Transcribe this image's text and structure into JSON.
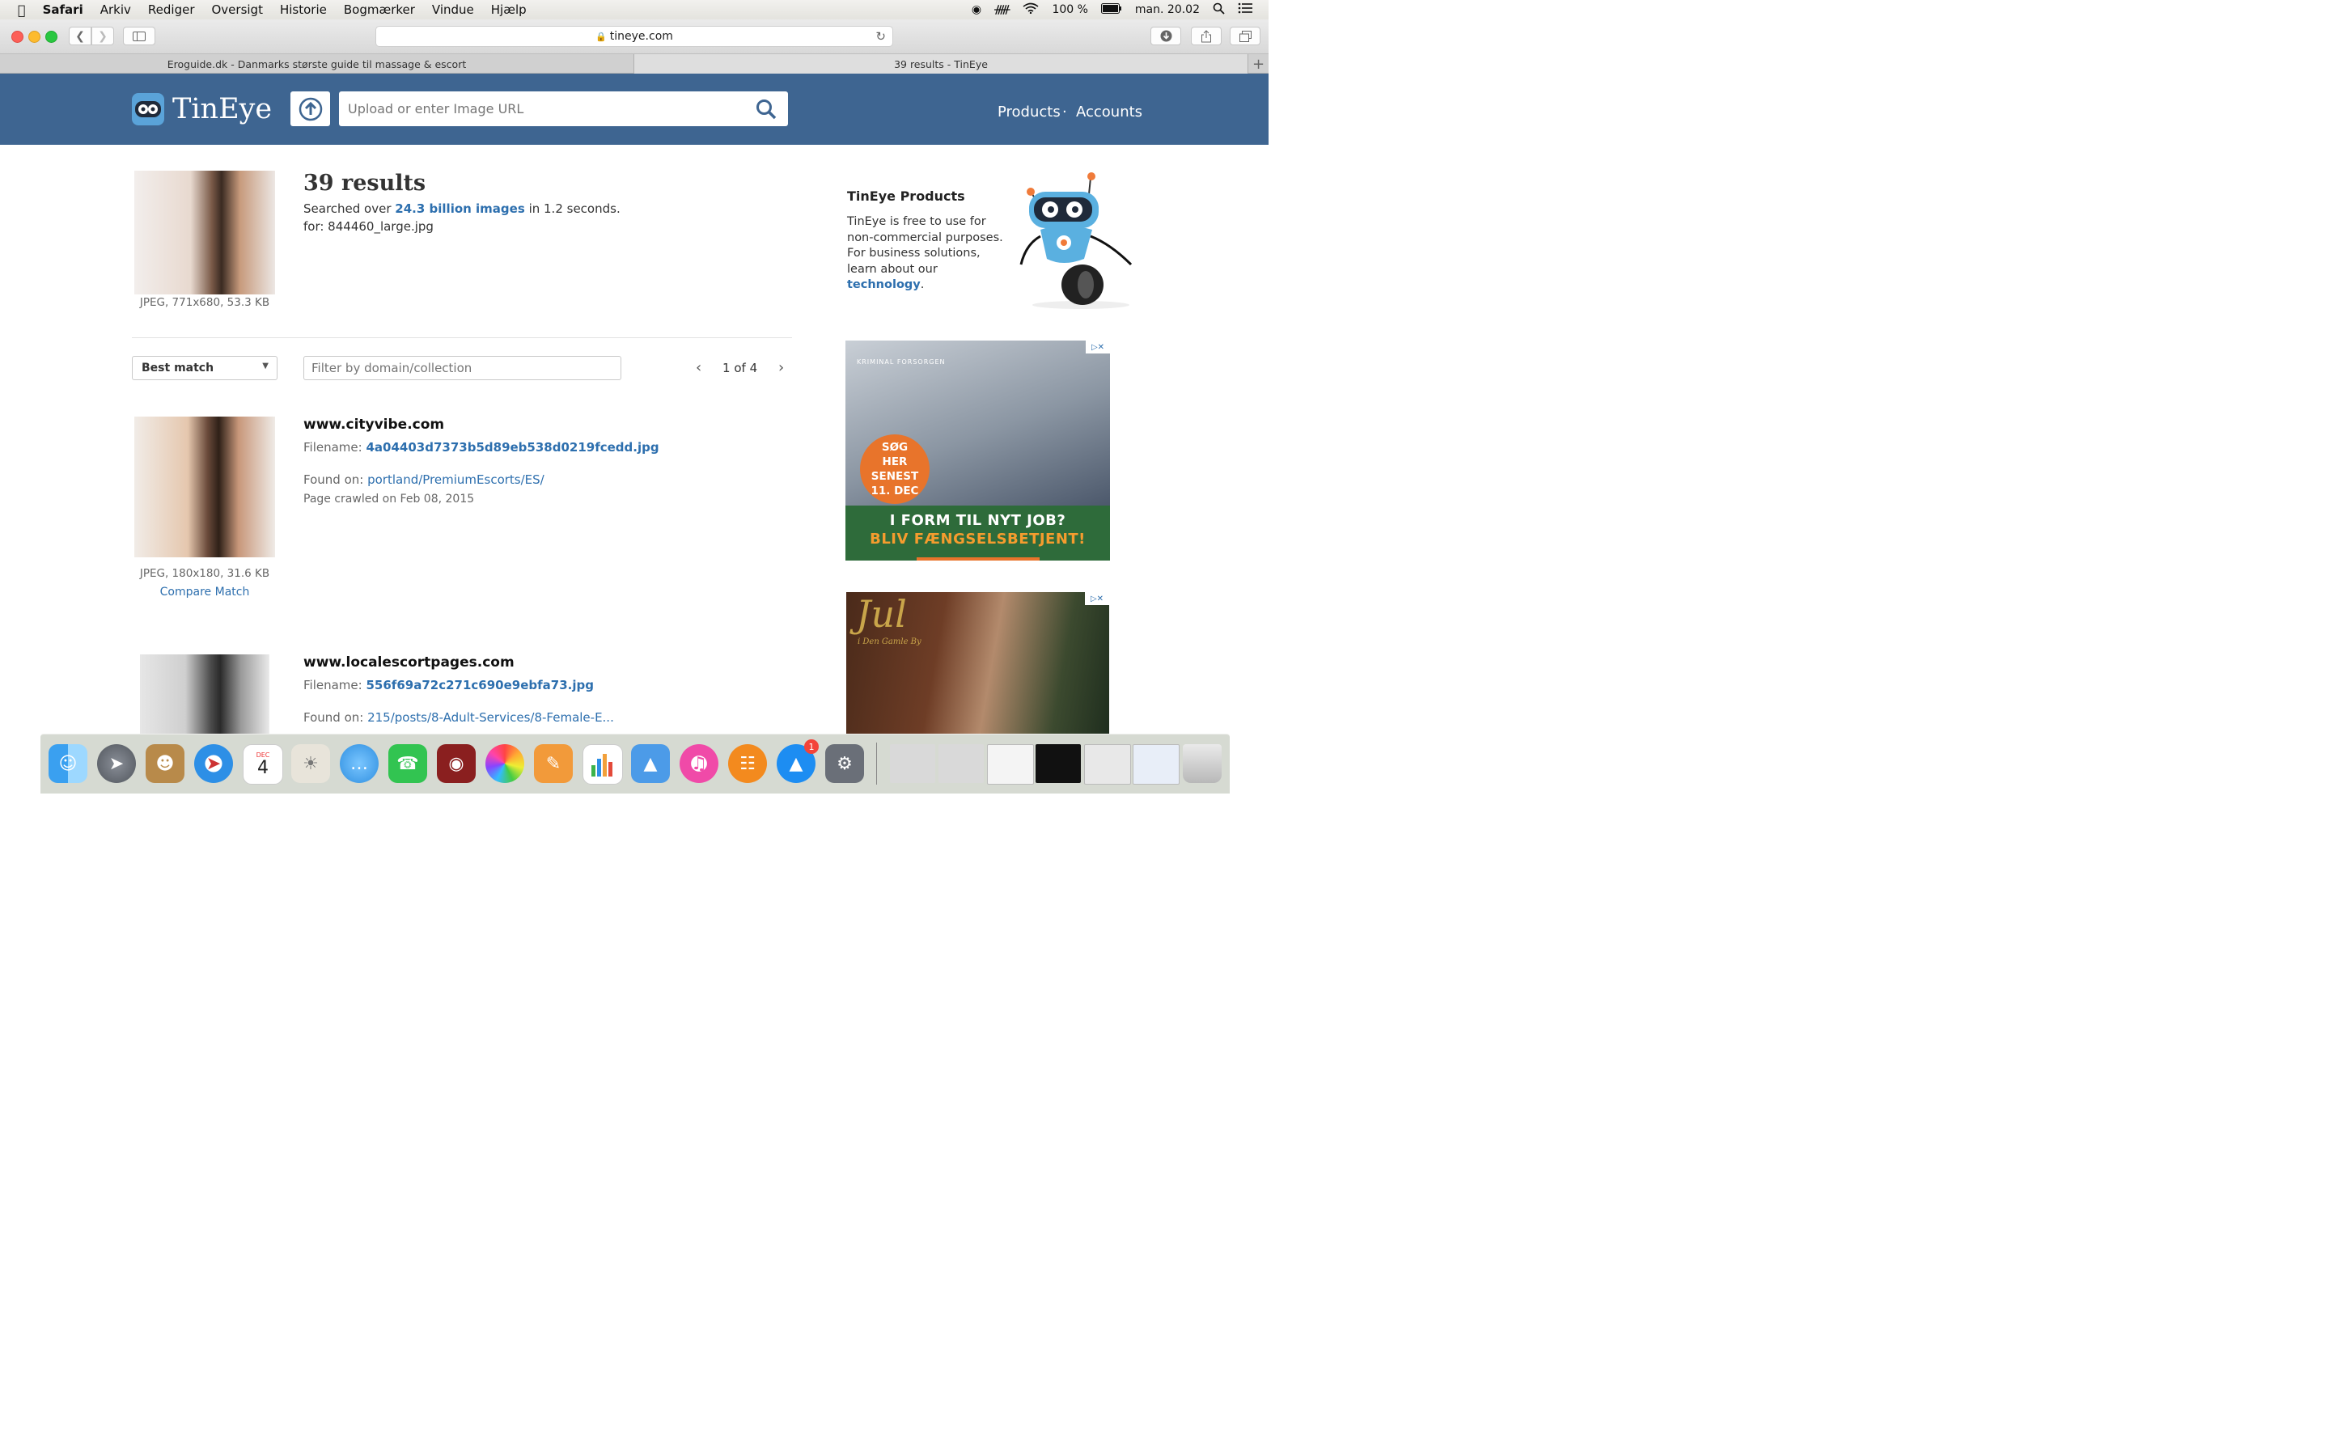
{
  "menubar": {
    "app": "Safari",
    "items": [
      "Arkiv",
      "Rediger",
      "Oversigt",
      "Historie",
      "Bogmærker",
      "Vindue",
      "Hjælp"
    ],
    "battery": "100 %",
    "clock": "man. 20.02"
  },
  "browser": {
    "url": "tineye.com",
    "tabs": [
      {
        "label": "Eroguide.dk - Danmarks største guide til massage & escort"
      },
      {
        "label": "39 results - TinEye"
      }
    ]
  },
  "header": {
    "logo_text": "TinEye",
    "search_placeholder": "Upload or enter Image URL",
    "nav": [
      "Products",
      "Accounts"
    ],
    "nav_sep": "·"
  },
  "query": {
    "image_info": "JPEG, 771x680, 53.3 KB",
    "results_title": "39 results",
    "searched_prefix": "Searched over",
    "searched_link": "24.3 billion images",
    "searched_suffix": "in 1.2 seconds.",
    "for_line": "for: 844460_large.jpg"
  },
  "controls": {
    "sort_label": "Best match",
    "filter_placeholder": "Filter by domain/collection",
    "page_current": "1",
    "page_of": "of",
    "page_total": "4"
  },
  "results": [
    {
      "domain": "www.cityvibe.com",
      "filename_label": "Filename:",
      "filename": "4a04403d7373b5d89eb538d0219fcedd.jpg",
      "found_label": "Found on:",
      "found": "portland/PremiumEscorts/ES/",
      "crawled": "Page crawled on Feb 08, 2015",
      "image_info": "JPEG, 180x180, 31.6 KB",
      "compare": "Compare Match"
    },
    {
      "domain": "www.localescortpages.com",
      "filename_label": "Filename:",
      "filename": "556f69a72c271c690e9ebfa73.jpg",
      "found_label": "Found on:",
      "found": "215/posts/8-Adult-Services/8-Female-E..."
    }
  ],
  "sidebar": {
    "title": "TinEye Products",
    "text": "TinEye is free to use for non-commercial purposes. For business solutions, learn about our",
    "link": "technology",
    "end": "."
  },
  "ads": {
    "ad1_brand": "KRIMINAL FORSORGEN",
    "ad1_badge": "SØG HER SENEST 11. DEC",
    "ad1_line1": "I FORM TIL NYT JOB?",
    "ad1_line2": "BLIV FÆNGSELSBETJENT!",
    "ad2_title": "Jul",
    "ad2_sub": "i Den Gamle By"
  },
  "dock": {
    "calendar_month": "DEC",
    "calendar_day": "4",
    "appstore_badge": "1"
  }
}
